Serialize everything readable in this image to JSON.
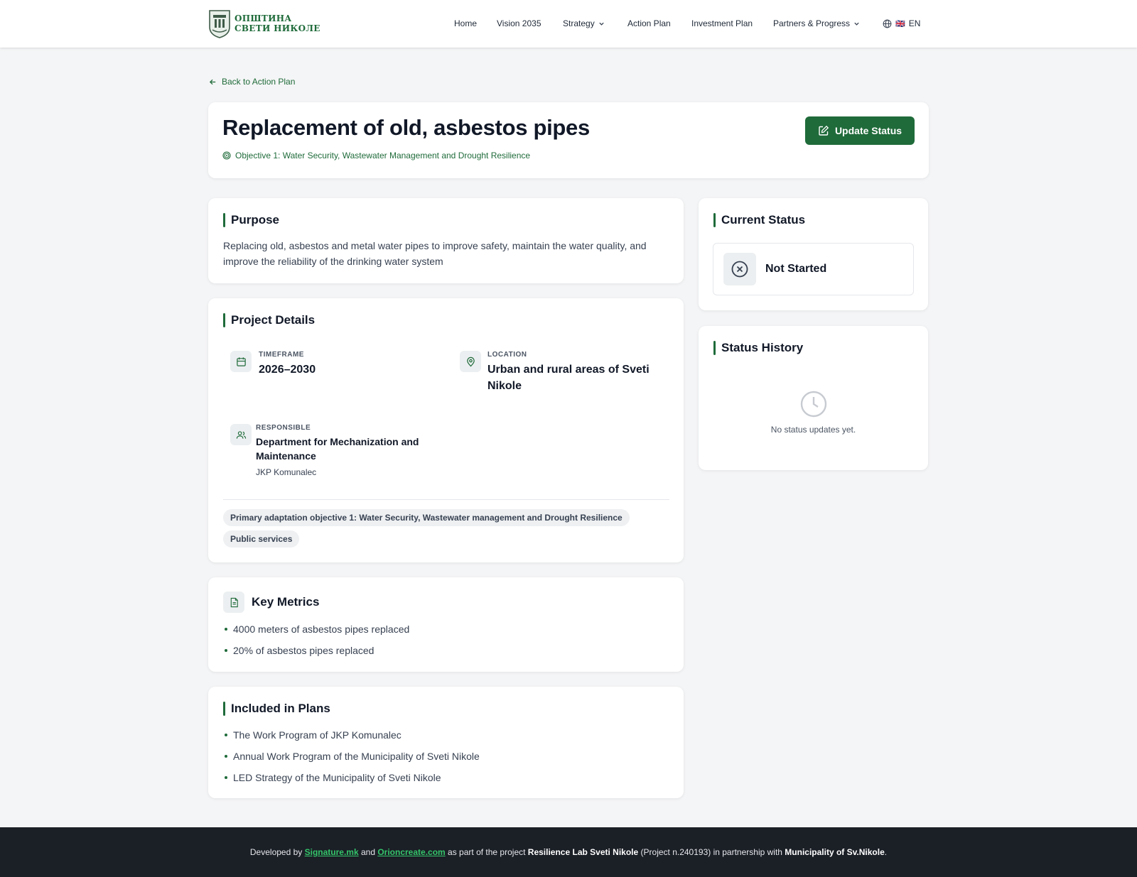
{
  "header": {
    "logo_line1": "ОПШТИНА",
    "logo_line2": "СВЕТИ НИКОЛЕ",
    "nav": [
      {
        "label": "Home"
      },
      {
        "label": "Vision 2035"
      },
      {
        "label": "Strategy",
        "has_dropdown": true
      },
      {
        "label": "Action Plan"
      },
      {
        "label": "Investment Plan"
      },
      {
        "label": "Partners & Progress",
        "has_dropdown": true
      }
    ],
    "language": {
      "flag": "🇬🇧",
      "code": "EN",
      "icon": "globe-icon"
    }
  },
  "back_link": {
    "label": "Back to Action Plan",
    "icon": "arrow-left-icon"
  },
  "page": {
    "title": "Replacement of old, asbestos pipes",
    "objective": "Objective 1: Water Security, Wastewater Management and Drought Resilience",
    "update_button": "Update Status"
  },
  "purpose": {
    "heading": "Purpose",
    "text": "Replacing old, asbestos and metal water pipes to improve safety, maintain the water quality, and improve the reliability of the drinking water system"
  },
  "details": {
    "heading": "Project Details",
    "timeframe": {
      "label": "TIMEFRAME",
      "value": "2026–2030"
    },
    "location": {
      "label": "LOCATION",
      "value": "Urban and rural areas of Sveti Nikole"
    },
    "responsible": {
      "label": "RESPONSIBLE",
      "value": "Department for Mechanization and Maintenance",
      "sub": "JKP Komunalec"
    },
    "tags": [
      "Primary adaptation objective 1: Water Security, Wastewater management and Drought Resilience",
      "Public services"
    ]
  },
  "metrics": {
    "heading": "Key Metrics",
    "items": [
      "4000 meters of asbestos pipes replaced",
      "20% of asbestos pipes replaced"
    ]
  },
  "plans": {
    "heading": "Included in Plans",
    "items": [
      "The Work Program of JKP Komunalec",
      "Annual Work Program of the Municipality of Sveti Nikole",
      "LED Strategy of the Municipality of Sveti Nikole"
    ]
  },
  "status": {
    "heading": "Current Status",
    "value": "Not Started"
  },
  "history": {
    "heading": "Status History",
    "empty_text": "No status updates yet."
  },
  "footer": {
    "t1": "Developed by ",
    "link1": "Signature.mk",
    "t2": " and ",
    "link2": "Orioncreate.com",
    "t3": " as part of the project ",
    "project": "Resilience Lab Sveti Nikole",
    "t4": " (Project n.240193) in partnership with ",
    "partner": "Municipality of Sv.Nikole",
    "t5": "."
  },
  "colors": {
    "brand_green": "#1f6b3a",
    "footer_bg": "#1b1f26",
    "link_green": "#34c46a"
  }
}
